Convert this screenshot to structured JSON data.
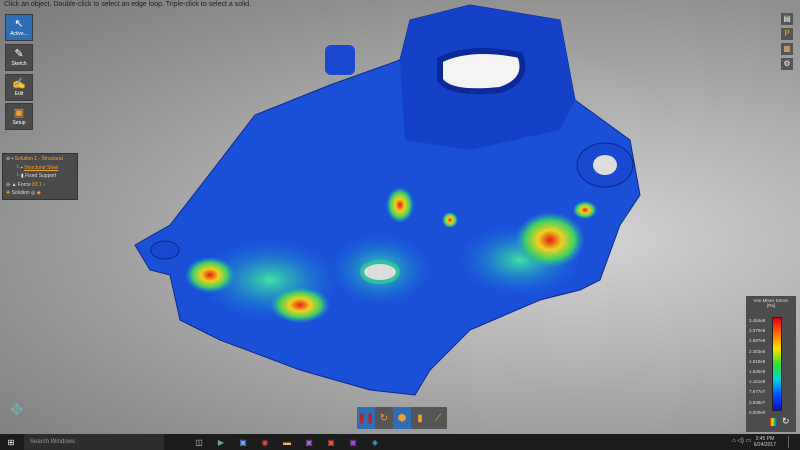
{
  "hint": "Click an object. Double-click to select an edge loop. Triple-click to select a solid.",
  "tools": [
    {
      "label": "Active...",
      "icon": "cursor-icon"
    },
    {
      "label": "Sketch",
      "icon": "pencil-icon"
    },
    {
      "label": "Edit",
      "icon": "brush-icon"
    },
    {
      "label": "Setup",
      "icon": "setup-icon"
    }
  ],
  "tree": {
    "root": "Solution 1 - Structural",
    "items": [
      "Structural Steel",
      "Fixed Support",
      "Force"
    ],
    "force_value": "83.1",
    "footer": "Solution"
  },
  "legend": {
    "title": "Von Mises Stress",
    "unit": "[Pa]",
    "values": [
      "3.454e8",
      "3.070e8",
      "2.687e8",
      "2.303e8",
      "1.919e8",
      "1.535e8",
      "1.151e8",
      "7.677e7",
      "3.838e7",
      "0.000e0"
    ],
    "colors": {
      "max": "#e00010",
      "min": "#1010c0"
    }
  },
  "taskbar": {
    "search": "Search Windows",
    "time": "2:45 PM",
    "date": "6/24/2017"
  }
}
